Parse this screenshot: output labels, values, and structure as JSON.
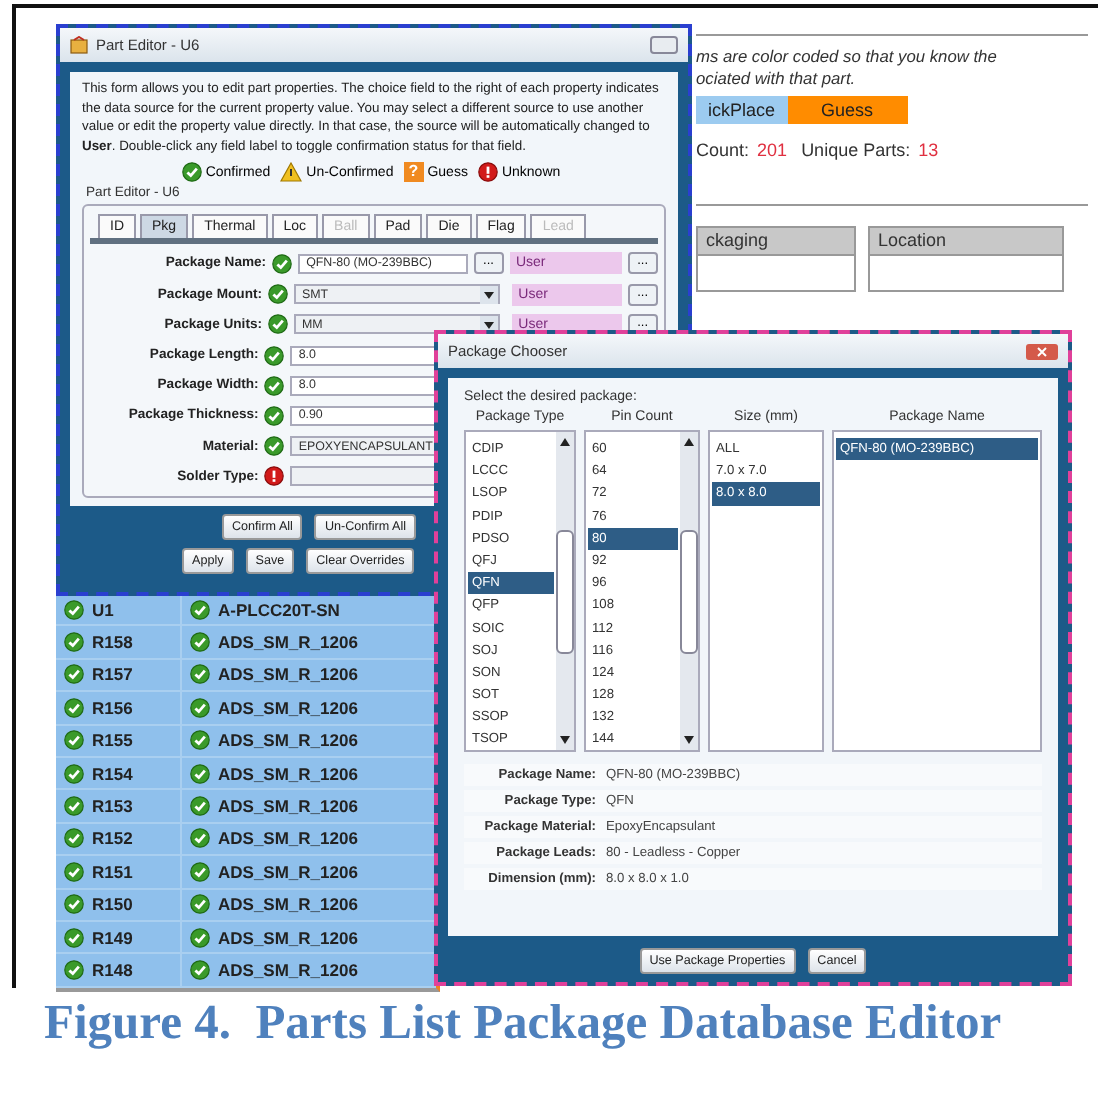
{
  "main_window": {
    "note_lines": [
      "ms are color coded so that you know the",
      "ociated with that part."
    ],
    "legend": [
      {
        "label": "ickPlace",
        "color": "#9ccbf0"
      },
      {
        "label": "Guess",
        "color": "#ff8c00"
      }
    ],
    "counts": [
      {
        "label": "Count:",
        "value": "201"
      },
      {
        "label": "Unique Parts:",
        "value": "13"
      }
    ],
    "table": {
      "columns": [
        "ckaging",
        "Location"
      ]
    },
    "parts": [
      {
        "ref": "U1",
        "part": "A-PLCC20T-SN",
        "confirmed": true
      },
      {
        "ref": "R158",
        "part": "ADS_SM_R_1206",
        "confirmed": true
      },
      {
        "ref": "R157",
        "part": "ADS_SM_R_1206",
        "confirmed": true
      },
      {
        "ref": "R156",
        "part": "ADS_SM_R_1206",
        "confirmed": true
      },
      {
        "ref": "R155",
        "part": "ADS_SM_R_1206",
        "confirmed": true
      },
      {
        "ref": "R154",
        "part": "ADS_SM_R_1206",
        "confirmed": true
      },
      {
        "ref": "R153",
        "part": "ADS_SM_R_1206",
        "confirmed": true
      },
      {
        "ref": "R152",
        "part": "ADS_SM_R_1206",
        "confirmed": true
      },
      {
        "ref": "R151",
        "part": "ADS_SM_R_1206",
        "confirmed": true
      },
      {
        "ref": "R150",
        "part": "ADS_SM_R_1206",
        "confirmed": true
      },
      {
        "ref": "R149",
        "part": "ADS_SM_R_1206",
        "confirmed": true
      },
      {
        "ref": "R148",
        "part": "ADS_SM_R_1206",
        "confirmed": true
      }
    ]
  },
  "part_editor": {
    "title": "Part Editor - U6",
    "description": "This form allows you to edit part properties. The choice field to the right of each property indicates the data source for the current property value. You may select a different source to use another value or edit the property value directly. In that case, the source will be automatically changed to **User**. Double-click any field label to toggle confirmation status for that field.",
    "status_legend": [
      {
        "kind": "confirmed",
        "label": "Confirmed"
      },
      {
        "kind": "unconfirmed",
        "label": "Un-Confirmed"
      },
      {
        "kind": "guess",
        "label": "Guess",
        "glyph": "?"
      },
      {
        "kind": "unknown",
        "label": "Unknown"
      }
    ],
    "group_title": "Part Editor - U6",
    "tabs": [
      {
        "label": "ID",
        "selected": false,
        "disabled": false
      },
      {
        "label": "Pkg",
        "selected": true,
        "disabled": false
      },
      {
        "label": "Thermal",
        "selected": false,
        "disabled": false
      },
      {
        "label": "Loc",
        "selected": false,
        "disabled": false
      },
      {
        "label": "Ball",
        "selected": false,
        "disabled": true
      },
      {
        "label": "Pad",
        "selected": false,
        "disabled": false
      },
      {
        "label": "Die",
        "selected": false,
        "disabled": false
      },
      {
        "label": "Flag",
        "selected": false,
        "disabled": false
      },
      {
        "label": "Lead",
        "selected": false,
        "disabled": true
      }
    ],
    "fields": [
      {
        "label": "Package Name:",
        "confirmed": true,
        "kind": "text",
        "value": "QFN-80 (MO-239BBC)",
        "browse": "...",
        "source": "User",
        "source_button": "..."
      },
      {
        "label": "Package Mount:",
        "confirmed": true,
        "kind": "select",
        "value": "SMT",
        "source": "User",
        "source_button": "..."
      },
      {
        "label": "Package Units:",
        "confirmed": true,
        "kind": "select",
        "value": "MM",
        "source": "User",
        "source_button": "..."
      },
      {
        "label": "Package Length:",
        "confirmed": true,
        "kind": "text",
        "value": "8.0"
      },
      {
        "label": "Package Width:",
        "confirmed": true,
        "kind": "text",
        "value": "8.0"
      },
      {
        "label": "Package Thickness:",
        "confirmed": true,
        "kind": "text",
        "value": "0.90"
      },
      {
        "label": "Material:",
        "confirmed": true,
        "kind": "combo",
        "value": "EPOXYENCAPSULANT"
      },
      {
        "label": "Solder Type:",
        "confirmed": false,
        "kind": "combo"
      }
    ],
    "buttons_row1": [
      "Confirm All",
      "Un-Confirm All"
    ],
    "buttons_row2": [
      "Apply",
      "Save",
      "Clear Overrides"
    ]
  },
  "package_chooser": {
    "title": "Package Chooser",
    "prompt": "Select the desired package:",
    "lists": [
      {
        "header": "Package Type",
        "scrollbar": true,
        "items": [
          {
            "label": "CDIP",
            "selected": false
          },
          {
            "label": "LCCC",
            "selected": false
          },
          {
            "label": "LSOP",
            "selected": false
          },
          {
            "label": "PDIP",
            "selected": false
          },
          {
            "label": "PDSO",
            "selected": false
          },
          {
            "label": "QFJ",
            "selected": false
          },
          {
            "label": "QFN",
            "selected": true
          },
          {
            "label": "QFP",
            "selected": false
          },
          {
            "label": "SOIC",
            "selected": false
          },
          {
            "label": "SOJ",
            "selected": false
          },
          {
            "label": "SON",
            "selected": false
          },
          {
            "label": "SOT",
            "selected": false
          },
          {
            "label": "SSOP",
            "selected": false
          },
          {
            "label": "TSOP",
            "selected": false
          }
        ]
      },
      {
        "header": "Pin Count",
        "scrollbar": true,
        "items": [
          {
            "label": "60",
            "selected": false
          },
          {
            "label": "64",
            "selected": false
          },
          {
            "label": "72",
            "selected": false
          },
          {
            "label": "76",
            "selected": false
          },
          {
            "label": "80",
            "selected": true
          },
          {
            "label": "92",
            "selected": false
          },
          {
            "label": "96",
            "selected": false
          },
          {
            "label": "108",
            "selected": false
          },
          {
            "label": "112",
            "selected": false
          },
          {
            "label": "116",
            "selected": false
          },
          {
            "label": "124",
            "selected": false
          },
          {
            "label": "128",
            "selected": false
          },
          {
            "label": "132",
            "selected": false
          },
          {
            "label": "144",
            "selected": false
          }
        ]
      },
      {
        "header": "Size (mm)",
        "scrollbar": false,
        "items": [
          {
            "label": "ALL",
            "selected": false
          },
          {
            "label": "7.0 x 7.0",
            "selected": false
          },
          {
            "label": "8.0 x 8.0",
            "selected": true
          }
        ]
      },
      {
        "header": "Package Name",
        "scrollbar": false,
        "items": [
          {
            "label": "QFN-80 (MO-239BBC)",
            "selected": true
          }
        ]
      }
    ],
    "details": [
      {
        "label": "Package Name:",
        "value": "QFN-80 (MO-239BBC)"
      },
      {
        "label": "Package Type:",
        "value": "QFN"
      },
      {
        "label": "Package Material:",
        "value": "EpoxyEncapsulant"
      },
      {
        "label": "Package Leads:",
        "value": "80 - Leadless - Copper"
      },
      {
        "label": "Dimension (mm):",
        "value": "8.0 x 8.0 x 1.0"
      }
    ],
    "buttons": [
      "Use Package Properties",
      "Cancel"
    ]
  },
  "figure_caption": "Figure 4.  Parts List Package Database Editor"
}
